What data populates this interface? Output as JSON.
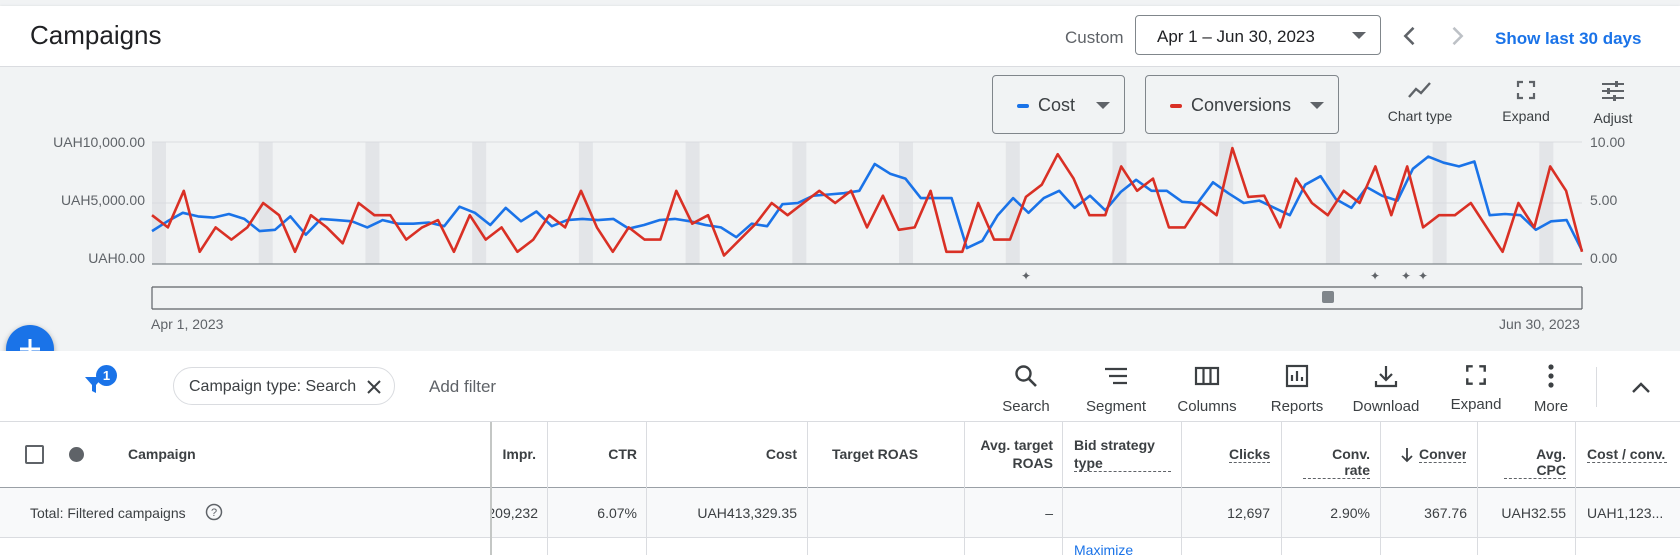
{
  "header": {
    "title": "Campaigns",
    "custom_label": "Custom",
    "date_range": "Apr 1 – Jun 30, 2023",
    "show_last": "Show last 30 days"
  },
  "chart_toolbar": {
    "metric1": {
      "label": "Cost",
      "color": "#1a73e8"
    },
    "metric2": {
      "label": "Conversions",
      "color": "#d93025"
    },
    "chart_type": "Chart type",
    "expand": "Expand",
    "adjust": "Adjust"
  },
  "chart_data": {
    "type": "line",
    "x_start_label": "Apr 1, 2023",
    "x_end_label": "Jun 30, 2023",
    "y_left_ticks": [
      "UAH10,000.00",
      "UAH5,000.00",
      "UAH0.00"
    ],
    "y_left_range": [
      0,
      10000
    ],
    "y_right_ticks": [
      "10.00",
      "5.00",
      "0.00"
    ],
    "y_right_range": [
      0,
      10
    ],
    "series": [
      {
        "name": "Cost",
        "color": "#1a73e8",
        "axis": "left",
        "values": [
          2700,
          3500,
          4200,
          3900,
          3800,
          4100,
          3700,
          2700,
          2800,
          3900,
          2400,
          3700,
          3600,
          3500,
          3000,
          3600,
          3300,
          3300,
          3400,
          3100,
          4700,
          4200,
          3200,
          4600,
          3500,
          4300,
          3100,
          3600,
          3700,
          3600,
          3700,
          2900,
          3200,
          3600,
          3700,
          3500,
          3200,
          3000,
          2200,
          3300,
          3100,
          4900,
          5000,
          5600,
          5700,
          5800,
          6000,
          8200,
          7400,
          7000,
          5400,
          5400,
          5400,
          1300,
          1900,
          4000,
          5400,
          4200,
          5400,
          6000,
          4600,
          5600,
          4400,
          5900,
          6900,
          6000,
          6000,
          5100,
          5000,
          6700,
          5800,
          5000,
          5200,
          4600,
          4000,
          6500,
          7200,
          5300,
          4600,
          6300,
          5600,
          5200,
          7800,
          8800,
          8300,
          8000,
          8400,
          4000,
          4100,
          4000,
          2800,
          3500,
          3600,
          1100
        ]
      },
      {
        "name": "Conversions",
        "color": "#d93025",
        "axis": "right",
        "values": [
          4,
          3,
          6,
          1,
          3,
          2,
          3,
          5,
          4,
          1,
          4,
          3,
          1.7,
          5,
          4,
          4,
          2,
          3,
          3.6,
          1,
          4,
          2,
          3,
          1,
          2,
          4,
          3,
          6,
          3,
          1,
          3,
          2,
          2,
          6,
          3.3,
          4,
          0.7,
          2,
          3.3,
          5,
          4,
          5,
          6,
          5,
          6,
          3,
          5.6,
          2.8,
          3,
          6,
          1,
          1,
          5,
          2,
          2,
          5.5,
          6.5,
          9,
          7,
          4,
          4,
          8,
          6,
          7,
          3,
          3,
          5,
          4,
          9.5,
          5.5,
          5.6,
          3,
          7,
          5,
          4,
          6,
          5,
          8,
          4,
          8,
          3,
          4,
          4,
          5,
          3,
          1,
          5,
          3,
          8,
          6,
          1
        ]
      }
    ],
    "weekend_bands": 13
  },
  "filter_bar": {
    "filter_count": "1",
    "chip_label": "Campaign type: Search",
    "add_filter": "Add filter",
    "tools": [
      "Search",
      "Segment",
      "Columns",
      "Reports",
      "Download",
      "Expand",
      "More"
    ]
  },
  "table": {
    "headers": {
      "campaign": "Campaign",
      "impr": "Impr.",
      "ctr": "CTR",
      "cost": "Cost",
      "target_roas": "Target ROAS",
      "avg_target_roas_1": "Avg. target",
      "avg_target_roas_2": "ROAS",
      "bid_strategy_1": "Bid strategy",
      "bid_strategy_2": "type",
      "clicks": "Clicks",
      "conv_rate": "Conv. rate",
      "conversions": "Conver",
      "avg_cpc": "Avg. CPC",
      "cost_conv": "Cost / conv."
    },
    "total": {
      "label": "Total: Filtered campaigns",
      "impr": "209,232",
      "ctr": "6.07%",
      "cost": "UAH413,329.35",
      "avg_target_roas": "–",
      "clicks": "12,697",
      "conv_rate": "2.90%",
      "conversions": "367.76",
      "avg_cpc": "UAH32.55",
      "cost_conv": "UAH1,123..."
    },
    "next_row_bid_strategy": "Maximize"
  }
}
